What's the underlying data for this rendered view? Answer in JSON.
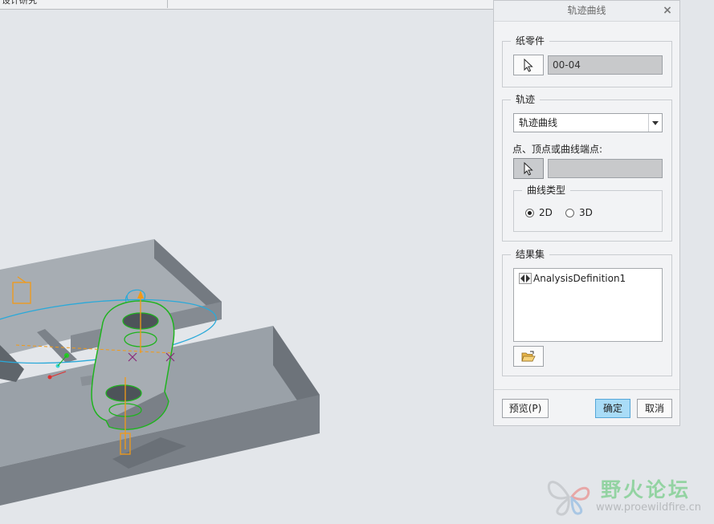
{
  "topbar": {
    "tab_label": "设计研究"
  },
  "dialog": {
    "title": "轨迹曲线",
    "close_glyph": "×",
    "paper_part": {
      "legend": "纸零件",
      "value": "00-04"
    },
    "trajectory": {
      "legend": "轨迹",
      "dropdown_value": "轨迹曲线",
      "points_label": "点、顶点或曲线端点:",
      "points_value": "",
      "curve_type": {
        "legend": "曲线类型",
        "options": [
          {
            "label": "2D",
            "selected": true
          },
          {
            "label": "3D",
            "selected": false
          }
        ]
      }
    },
    "results": {
      "legend": "结果集",
      "items": [
        {
          "label": "AnalysisDefinition1",
          "icon": "analysis-arrows-icon"
        }
      ],
      "open_icon": "folder-open-icon"
    },
    "buttons": {
      "preview": "预览(P)",
      "ok": "确定",
      "cancel": "取消"
    }
  },
  "watermark": {
    "brand": "野火论坛",
    "url": "www.proewildfire.cn"
  },
  "colors": {
    "accent": "#a9dcf7",
    "model": "#8d949c",
    "curve": "#2aa9d9",
    "highlight": "#1fb31f",
    "datum": "#f39a16"
  }
}
